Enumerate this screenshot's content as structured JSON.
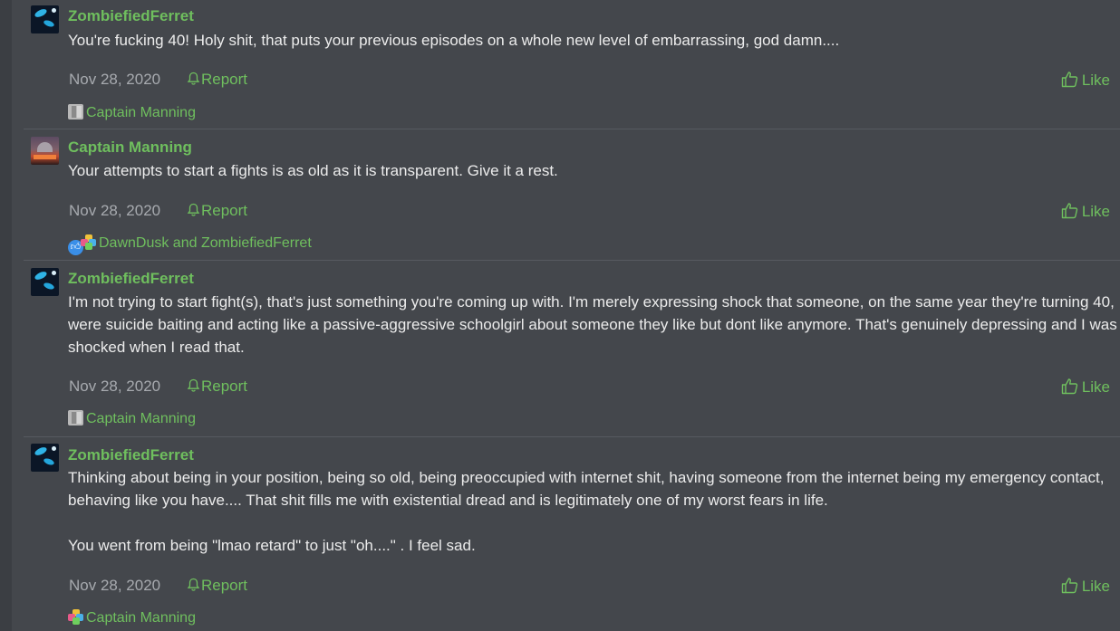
{
  "posts": [
    {
      "username": "ZombiefiedFerret",
      "avatar": "ferret-avatar",
      "paragraphs": [
        "You're fucking 40! Holy shit, that puts your previous episodes on a whole new level of embarrassing, god damn...."
      ],
      "date": "Nov 28, 2020",
      "report_label": "Report",
      "like_label": "Like",
      "reactions": {
        "icons": [
          "medal-icon"
        ],
        "text": "Captain Manning"
      }
    },
    {
      "username": "Captain Manning",
      "avatar": "captain-avatar",
      "paragraphs": [
        "Your attempts to start a fights is as old as it is transparent. Give it a rest."
      ],
      "date": "Nov 28, 2020",
      "report_label": "Report",
      "like_label": "Like",
      "reactions": {
        "icons": [
          "like-reaction-icon",
          "puzzle-reaction-icon"
        ],
        "text": "DawnDusk and ZombiefiedFerret"
      }
    },
    {
      "username": "ZombiefiedFerret",
      "avatar": "ferret-avatar",
      "paragraphs": [
        "I'm not trying to start fight(s), that's just something you're coming up with. I'm merely expressing shock that someone, on the same year they're turning 40, were suicide baiting and acting like a passive-aggressive schoolgirl about someone they like but dont like anymore. That's genuinely depressing and I was shocked when I read that."
      ],
      "date": "Nov 28, 2020",
      "report_label": "Report",
      "like_label": "Like",
      "reactions": {
        "icons": [
          "medal-icon"
        ],
        "text": "Captain Manning"
      }
    },
    {
      "username": "ZombiefiedFerret",
      "avatar": "ferret-avatar",
      "paragraphs": [
        "Thinking about being in your position, being so old, being preoccupied with internet shit, having someone from the internet being my emergency contact, behaving like you have.... That shit fills me with existential dread and is legitimately one of my worst fears in life.",
        "You went from being \"lmao retard\" to just \"oh....\" . I feel sad."
      ],
      "date": "Nov 28, 2020",
      "report_label": "Report",
      "like_label": "Like",
      "reactions": {
        "icons": [
          "puzzle-reaction-icon"
        ],
        "text": "Captain Manning"
      }
    }
  ],
  "colors": {
    "background": "#44474c",
    "accent": "#6fbf5e",
    "text": "#ececec",
    "muted": "#a7aaaf"
  }
}
